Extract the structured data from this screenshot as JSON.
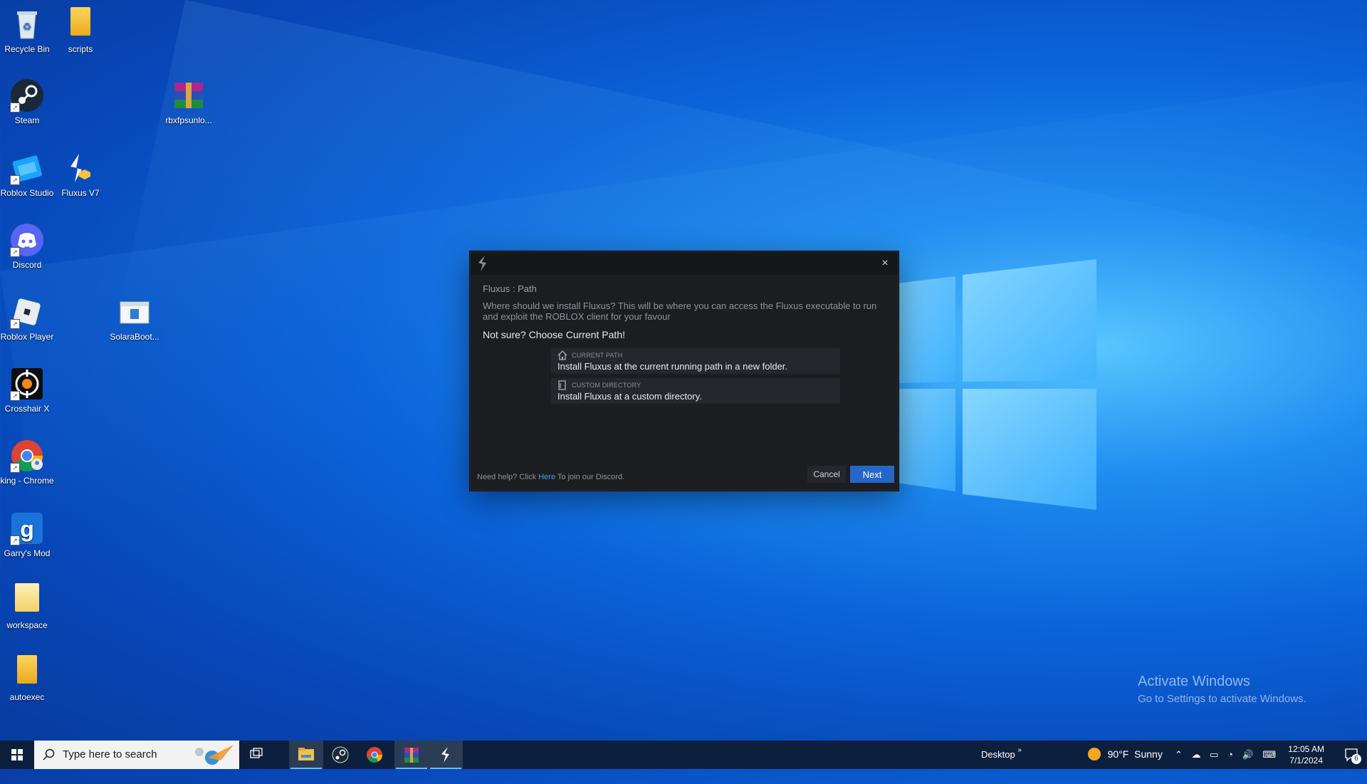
{
  "desktop": {
    "icons": [
      {
        "label": "Recycle Bin",
        "icon": "recycle-bin-icon"
      },
      {
        "label": "scripts",
        "icon": "folder-icon"
      },
      {
        "label": "Steam",
        "icon": "steam-icon"
      },
      {
        "label": "rbxfpsunlo...",
        "icon": "winrar-archive-icon"
      },
      {
        "label": "Roblox Studio",
        "icon": "roblox-studio-icon"
      },
      {
        "label": "Fluxus V7",
        "icon": "fluxus-icon"
      },
      {
        "label": "Discord",
        "icon": "discord-icon"
      },
      {
        "label": "Roblox Player",
        "icon": "roblox-player-icon"
      },
      {
        "label": "SolaraBoot...",
        "icon": "solara-icon"
      },
      {
        "label": "Crosshair X",
        "icon": "crosshair-icon"
      },
      {
        "label": "king - Chrome",
        "icon": "chrome-profile-icon"
      },
      {
        "label": "Garry's Mod",
        "icon": "garrys-mod-icon"
      },
      {
        "label": "workspace",
        "icon": "folder-icon"
      },
      {
        "label": "autoexec",
        "icon": "folder-icon"
      }
    ]
  },
  "dialog": {
    "heading": "Fluxus : Path",
    "description": "Where should we install Fluxus? This will be where you can access the Fluxus executable to run and exploit the ROBLOX client for your favour",
    "hint": "Not sure? Choose Current Path!",
    "options": [
      {
        "label": "CURRENT PATH",
        "text": "Install Fluxus at the current running path in a new folder.",
        "icon": "home-icon"
      },
      {
        "label": "CUSTOM DIRECTORY",
        "text": "Install Fluxus at a custom directory.",
        "icon": "folder-outline-icon"
      }
    ],
    "footer_prefix": "Need help? Click",
    "footer_link": "Here",
    "footer_suffix": "To join our Discord.",
    "cancel": "Cancel",
    "next": "Next",
    "close": "×"
  },
  "watermark": {
    "title": "Activate Windows",
    "subtitle": "Go to Settings to activate Windows."
  },
  "taskbar": {
    "search_placeholder": "Type here to search",
    "desktop_label": "Desktop",
    "weather": "90°F  Sunny",
    "time": "12:05 AM",
    "date": "7/1/2024",
    "notification_count": "6",
    "apps": [
      "task-view-icon",
      "file-explorer-icon",
      "steam-icon",
      "chrome-icon",
      "winrar-icon",
      "fluxus-icon"
    ]
  },
  "colors": {
    "accent": "#2566c9",
    "dialog_bg": "#1b1d20",
    "taskbar_bg": "#0c1f3c"
  }
}
